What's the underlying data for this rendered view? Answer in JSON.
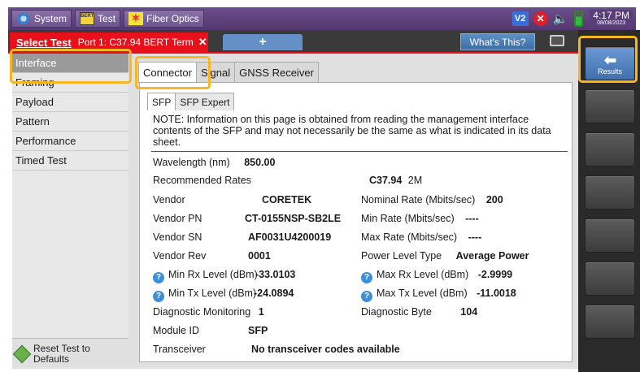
{
  "topbar": {
    "items": [
      {
        "label": "System",
        "icon": "gear-icon"
      },
      {
        "label": "Test",
        "icon": "bert-icon",
        "icon_text": "BERT"
      },
      {
        "label": "Fiber Optics",
        "icon": "fiber-optics-icon"
      }
    ],
    "status": {
      "v2": "V2",
      "time": "4:17 PM",
      "date": "08/08/2023"
    }
  },
  "tabbar": {
    "select_label": "Select Test",
    "port_tab": "Port 1: C37.94 BERT Term",
    "close": "✕",
    "add": "+",
    "whats_this": "What's This?"
  },
  "sidebar": {
    "items": [
      "Interface",
      "Framing",
      "Payload",
      "Pattern",
      "Performance",
      "Timed Test"
    ],
    "active_index": 0,
    "reset_label_1": "Reset Test to",
    "reset_label_2": "Defaults"
  },
  "content": {
    "tabs": [
      "Connector",
      "Signal",
      "GNSS Receiver"
    ],
    "active_tab": "Connector",
    "subtabs": [
      "SFP",
      "SFP Expert"
    ],
    "active_subtab": "SFP",
    "note": "NOTE: Information on this page is obtained from reading the management interface contents of the SFP and may not necessarily be the same as what is indicated in its data sheet.",
    "fields": {
      "wavelength": {
        "label": "Wavelength (nm)",
        "value": "850.00"
      },
      "recommended_rates": {
        "label": "Recommended Rates",
        "value": "C37.94",
        "value2": "2M"
      },
      "vendor": {
        "label": "Vendor",
        "value": "CORETEK"
      },
      "vendor_pn": {
        "label": "Vendor PN",
        "value": "CT-0155NSP-SB2LE"
      },
      "vendor_sn": {
        "label": "Vendor SN",
        "value": "AF0031U4200019"
      },
      "vendor_rev": {
        "label": "Vendor Rev",
        "value": "0001"
      },
      "min_rx": {
        "label": "Min Rx Level (dBm)",
        "value": "-33.0103"
      },
      "min_tx": {
        "label": "Min Tx Level (dBm)",
        "value": "-24.0894"
      },
      "diag_monitoring": {
        "label": "Diagnostic Monitoring",
        "value": "1"
      },
      "module_id": {
        "label": "Module ID",
        "value": "SFP"
      },
      "transceiver": {
        "label": "Transceiver",
        "value": "No transceiver codes available"
      },
      "nominal_rate": {
        "label": "Nominal Rate (Mbits/sec)",
        "value": "200"
      },
      "min_rate": {
        "label": "Min Rate (Mbits/sec)",
        "value": "----"
      },
      "max_rate": {
        "label": "Max Rate (Mbits/sec)",
        "value": "----"
      },
      "power_level_type": {
        "label": "Power Level Type",
        "value": "Average Power"
      },
      "max_rx": {
        "label": "Max Rx Level (dBm)",
        "value": "-2.9999"
      },
      "max_tx": {
        "label": "Max Tx Level (dBm)",
        "value": "-11.0018"
      },
      "diag_byte": {
        "label": "Diagnostic Byte",
        "value": "104"
      }
    }
  },
  "right_panel": {
    "results_label": "Results"
  },
  "colors": {
    "accent_red": "#e8101a",
    "highlight": "#f6b722",
    "topbar": "#5c4180",
    "results_blue": "#4f82c2"
  }
}
